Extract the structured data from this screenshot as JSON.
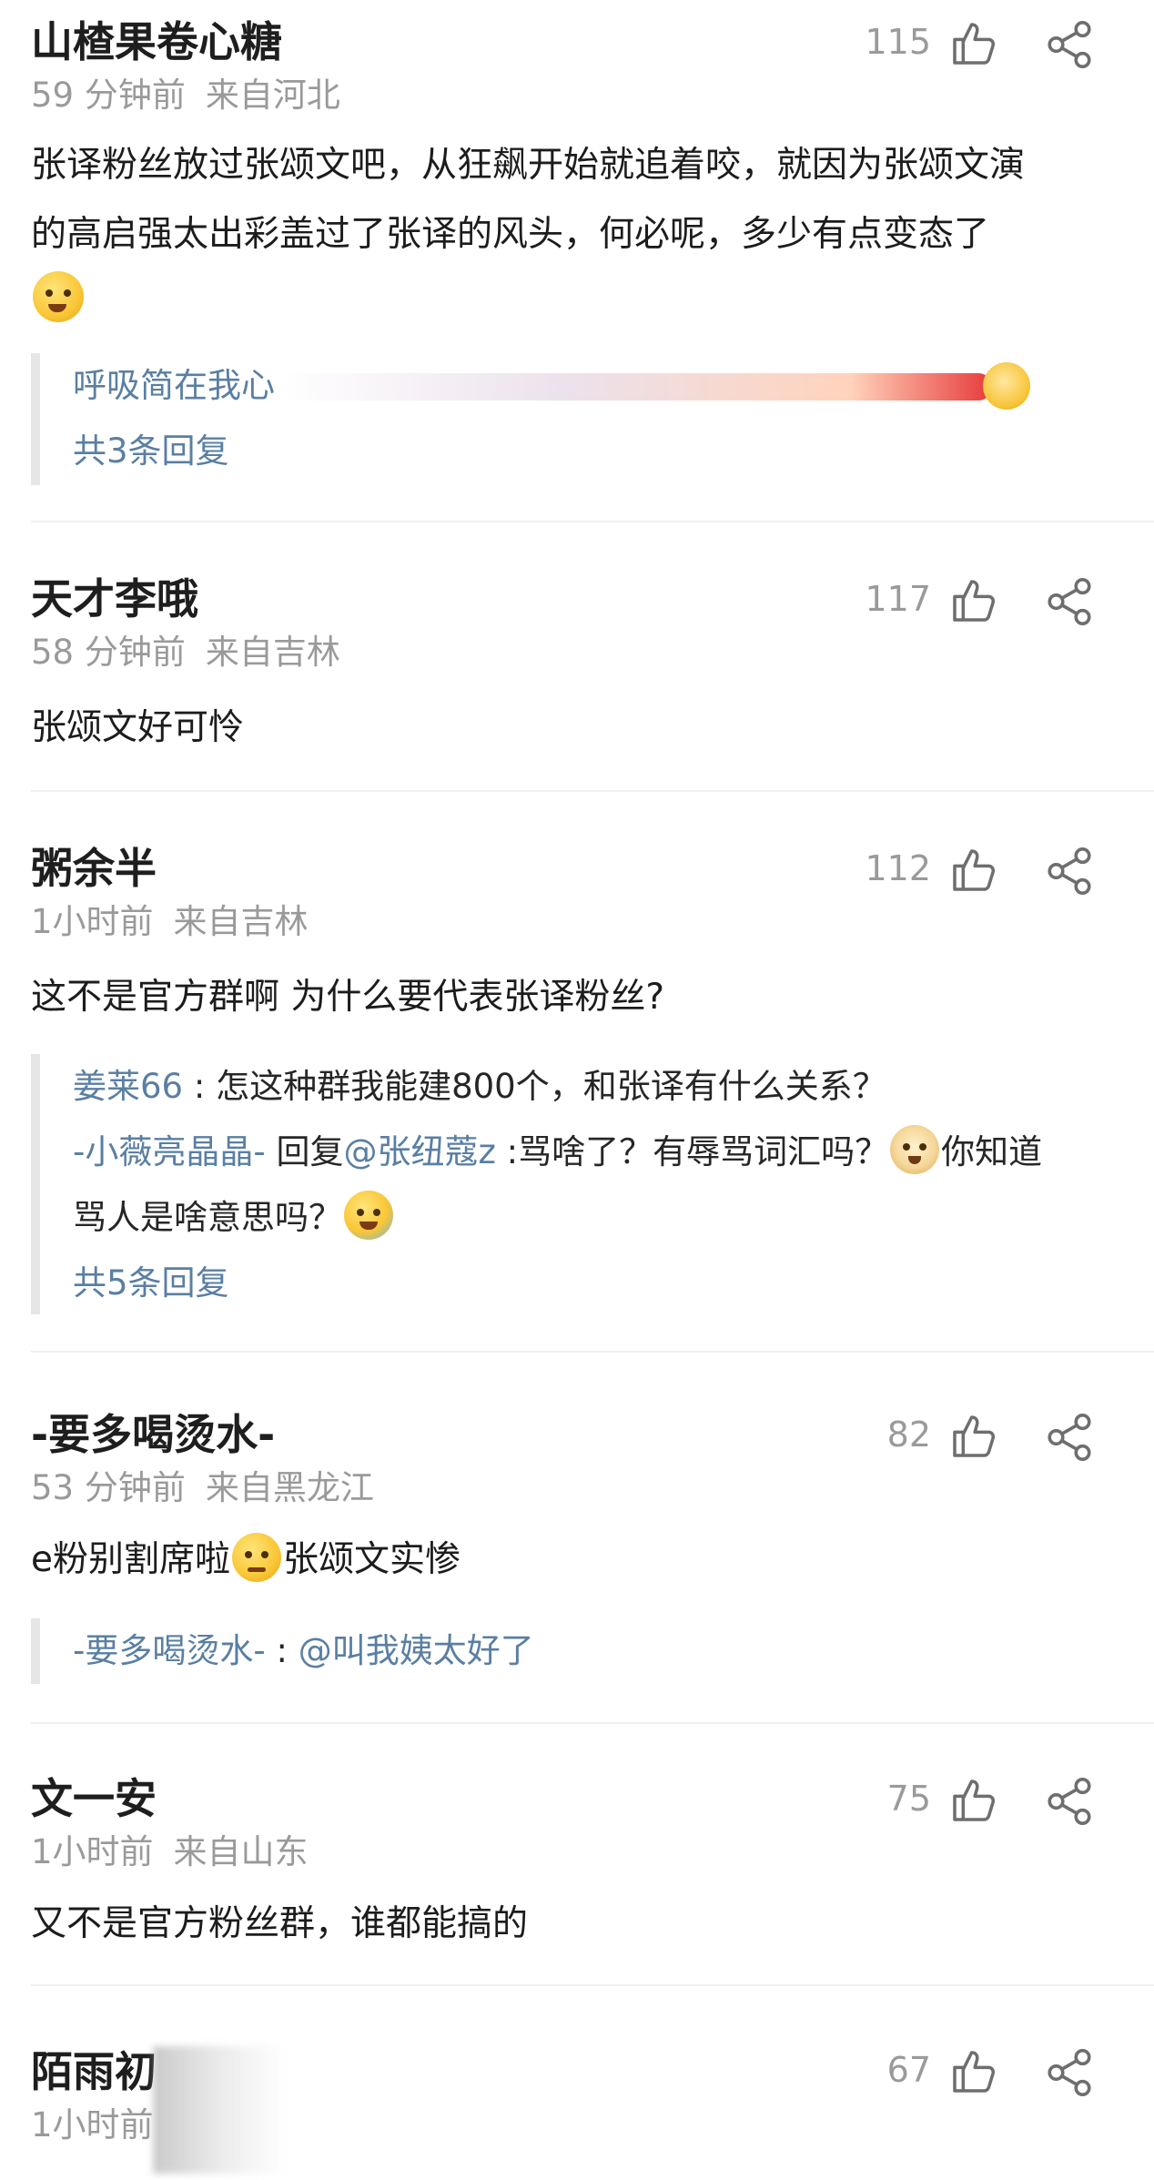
{
  "comments": [
    {
      "username": "山楂果卷心糖",
      "time": "59 分钟前",
      "location": "来自河北",
      "likes": "115",
      "content_line1": "张译粉丝放过张颂文吧，从狂飙开始就追着咬，就因为张颂文演",
      "content_line2": "的高启强太出彩盖过了张译的风头，何必呢，多少有点变态了",
      "emoji": "laugh-cry-emoji",
      "replies": [
        {
          "name": "呼吸简在我心"
        }
      ],
      "reply_total": "共3条回复"
    },
    {
      "username": "天才李哦",
      "time": "58 分钟前",
      "location": "来自吉林",
      "likes": "117",
      "content": "张颂文好可怜"
    },
    {
      "username": "粥余半",
      "time": "1小时前",
      "location": "来自吉林",
      "likes": "112",
      "content": "这不是官方群啊 为什么要代表张译粉丝?",
      "replies": [
        {
          "name": "姜莱66",
          "sep": " : ",
          "text": "怎这种群我能建800个，和张译有什么关系？"
        },
        {
          "name": "-小薇亮晶晶-",
          "reply_word": " 回复",
          "mention": "@张纽蔻z",
          "text": " :骂啥了？有辱骂词汇吗？",
          "text2": "你知道",
          "text3": "骂人是啥意思吗？"
        }
      ],
      "reply_total": "共5条回复"
    },
    {
      "username": "-要多喝烫水-",
      "time": "53 分钟前",
      "location": "来自黑龙江",
      "likes": "82",
      "content_a": "e粉别割席啦",
      "content_b": "张颂文实惨",
      "replies": [
        {
          "name": "-要多喝烫水-",
          "sep": " : ",
          "mention": "@叫我姨太好了"
        }
      ]
    },
    {
      "username": "文一安",
      "time": "1小时前",
      "location": "来自山东",
      "likes": "75",
      "content": "又不是官方粉丝群，谁都能搞的"
    },
    {
      "username": "陌雨初",
      "time": "1小时前",
      "location": "",
      "likes": "67"
    }
  ],
  "icons": {
    "like": "thumbs-up-outline-icon",
    "share": "share-nodes-icon"
  },
  "colors": {
    "link": "#5a7fa3",
    "meta": "#9a9a9a",
    "text": "#1c1c1c"
  }
}
